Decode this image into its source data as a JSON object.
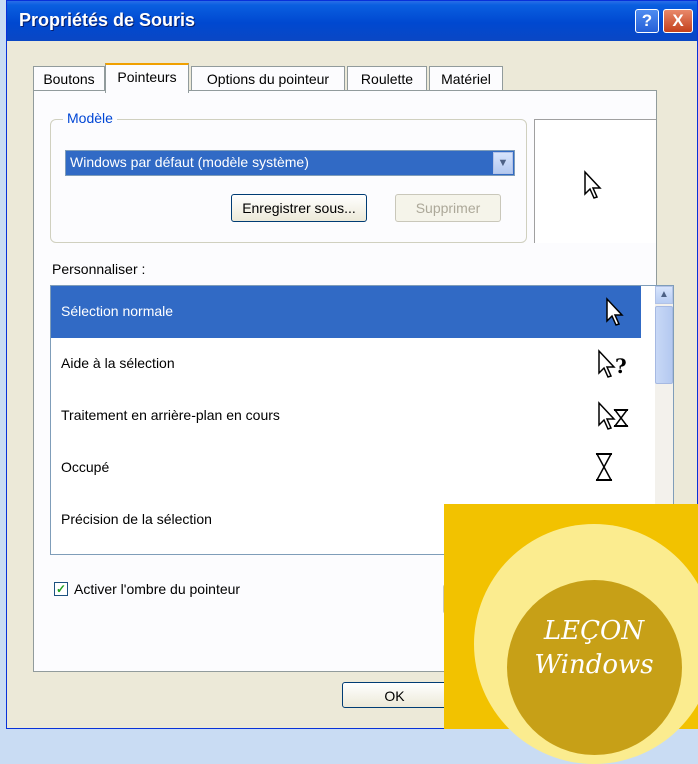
{
  "window": {
    "title": "Propriétés de Souris"
  },
  "title_buttons": {
    "help": "?",
    "close": "X"
  },
  "tabs": [
    {
      "label": "Boutons"
    },
    {
      "label": "Pointeurs"
    },
    {
      "label": "Options du pointeur"
    },
    {
      "label": "Roulette"
    },
    {
      "label": "Matériel"
    }
  ],
  "scheme": {
    "label": "Modèle",
    "selected": "Windows par défaut (modèle système)",
    "save_as": "Enregistrer sous...",
    "delete": "Supprimer"
  },
  "customize": {
    "label": "Personnaliser :",
    "items": [
      {
        "label": "Sélection normale",
        "icon": "arrow-cursor-icon"
      },
      {
        "label": "Aide à la sélection",
        "icon": "help-cursor-icon"
      },
      {
        "label": "Traitement en arrière-plan en cours",
        "icon": "working-cursor-icon"
      },
      {
        "label": "Occupé",
        "icon": "hourglass-icon"
      },
      {
        "label": "Précision de la sélection",
        "icon": "crosshair-icon"
      }
    ]
  },
  "shadow": {
    "label": "Activer l'ombre du pointeur",
    "checked": true
  },
  "buttons": {
    "ok": "OK"
  },
  "badge": {
    "line1": "LEÇON",
    "line2": "Windows"
  },
  "colors": {
    "selection": "#316ac5",
    "title_blue": "#0048d0",
    "badge_gold": "#f2c200"
  }
}
